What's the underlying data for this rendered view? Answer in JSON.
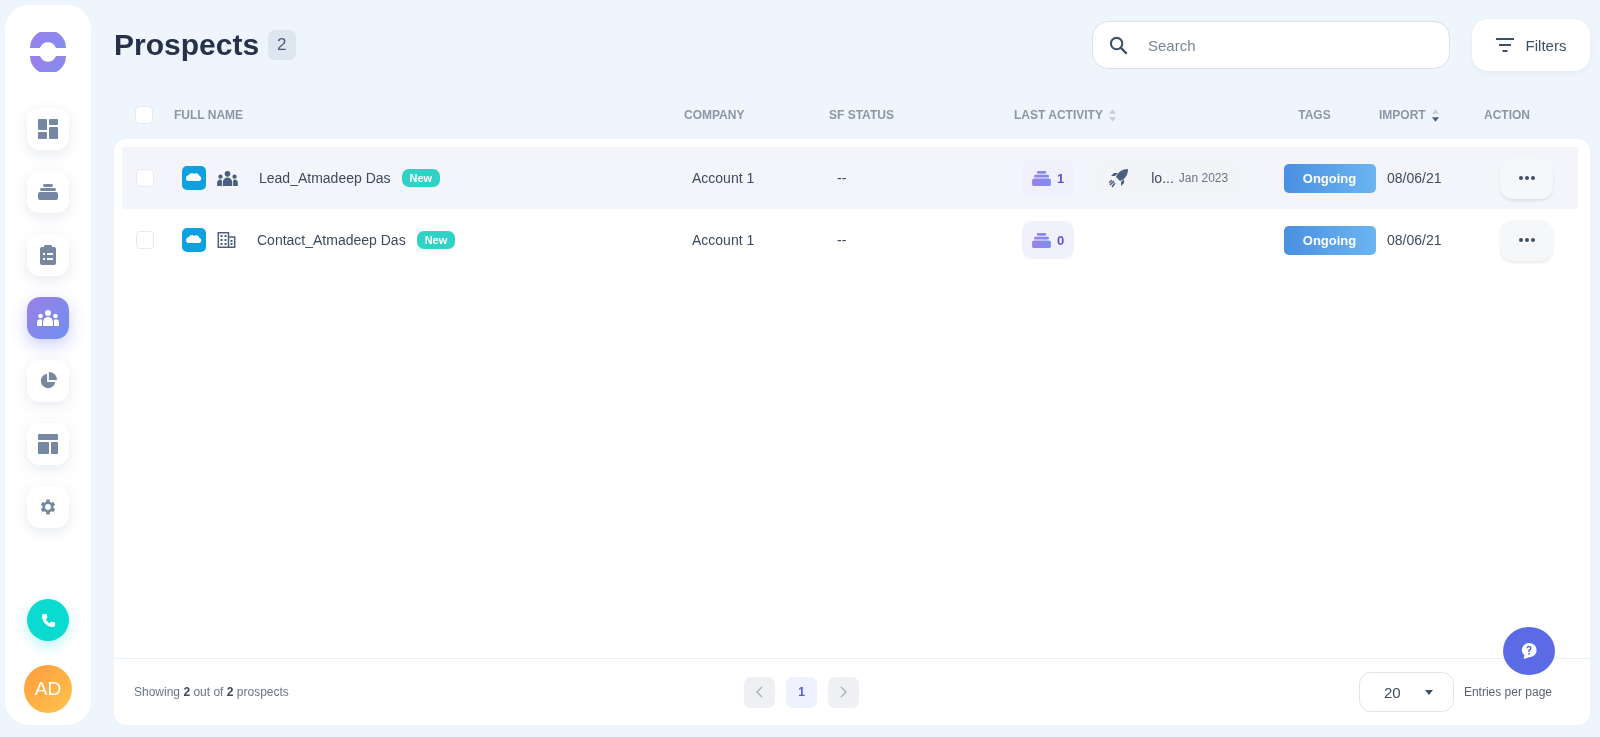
{
  "nav": [
    {
      "kind": "dashboard",
      "selected": false
    },
    {
      "kind": "stack",
      "selected": false
    },
    {
      "kind": "clipboard",
      "selected": false
    },
    {
      "kind": "people",
      "selected": true
    },
    {
      "kind": "pie",
      "selected": false
    },
    {
      "kind": "layout",
      "selected": false
    },
    {
      "kind": "gear",
      "selected": false
    }
  ],
  "avatar": "AD",
  "page": {
    "title": "Prospects",
    "count": "2"
  },
  "search": {
    "placeholder": "Search"
  },
  "filters_button": "Filters",
  "table": {
    "select_all_checked": false,
    "columns": [
      {
        "label": "FULL NAME",
        "sortable": false,
        "sorted_desc": false
      },
      {
        "label": "COMPANY",
        "sortable": false,
        "sorted_desc": false
      },
      {
        "label": "SF STATUS",
        "sortable": false,
        "sorted_desc": false
      },
      {
        "label": "LAST ACTIVITY",
        "sortable": true,
        "sorted_desc": false
      },
      {
        "label": "TAGS",
        "sortable": false,
        "sorted_desc": false
      },
      {
        "label": "IMPORT",
        "sortable": true,
        "sorted_desc": true
      },
      {
        "label": "ACTION",
        "sortable": false,
        "sorted_desc": false
      }
    ],
    "rows": [
      {
        "checked": false,
        "kind": "lead",
        "name": "Lead_Atmadeep Das",
        "badge": "New",
        "company": "Account 1",
        "sf_status": "--",
        "activity_count": "1",
        "activity": {
          "label": "lo...",
          "date": "Jan 2023"
        },
        "tag": "Ongoing",
        "import": "08/06/21",
        "highlighted": true
      },
      {
        "checked": false,
        "kind": "contact",
        "name": "Contact_Atmadeep Das",
        "badge": "New",
        "company": "Account 1",
        "sf_status": "--",
        "activity_count": "0",
        "tag": "Ongoing",
        "import": "08/06/21",
        "highlighted": false
      }
    ]
  },
  "footer": {
    "showing": "Showing **2** out of **2** prospects",
    "pages": [
      {
        "label": "1",
        "selected": true
      }
    ],
    "per_page": "20",
    "per_page_label": "Entries per page"
  }
}
